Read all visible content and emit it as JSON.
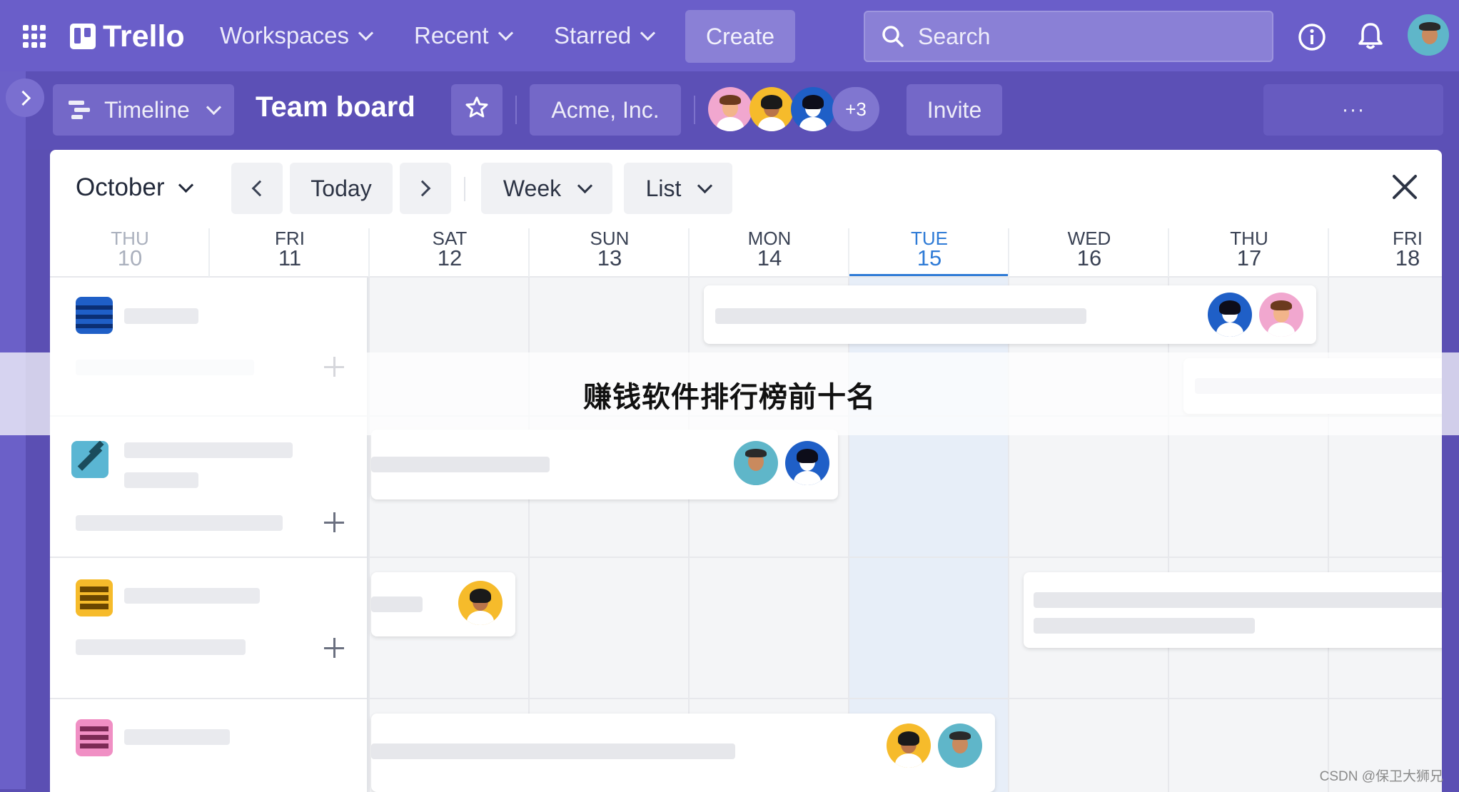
{
  "topbar": {
    "app_name": "Trello",
    "menus": [
      "Workspaces",
      "Recent",
      "Starred"
    ],
    "create_label": "Create",
    "search_placeholder": "Search",
    "icons": [
      "apps-grid-icon",
      "trello-logo-icon",
      "info-icon",
      "bell-icon",
      "profile-avatar"
    ]
  },
  "board": {
    "view_label": "Timeline",
    "title": "Team board",
    "workspace": "Acme, Inc.",
    "members_extra": "+3",
    "invite_label": "Invite",
    "more_label": "···"
  },
  "calendar": {
    "month": "October",
    "today_label": "Today",
    "range_label": "Week",
    "group_label": "List",
    "days": [
      {
        "dow": "THU",
        "num": "10"
      },
      {
        "dow": "FRI",
        "num": "11"
      },
      {
        "dow": "SAT",
        "num": "12"
      },
      {
        "dow": "SUN",
        "num": "13"
      },
      {
        "dow": "MON",
        "num": "14"
      },
      {
        "dow": "TUE",
        "num": "15"
      },
      {
        "dow": "WED",
        "num": "16"
      },
      {
        "dow": "THU",
        "num": "17"
      },
      {
        "dow": "FRI",
        "num": "18"
      }
    ],
    "today_index": 5
  },
  "overlay": {
    "title": "赚钱软件排行榜前十名"
  },
  "watermark": "CSDN @保卫大狮兄",
  "colors": {
    "topbar": "#6a5ec9",
    "accent_today": "#2f7bd6",
    "panel": "#ffffff"
  }
}
